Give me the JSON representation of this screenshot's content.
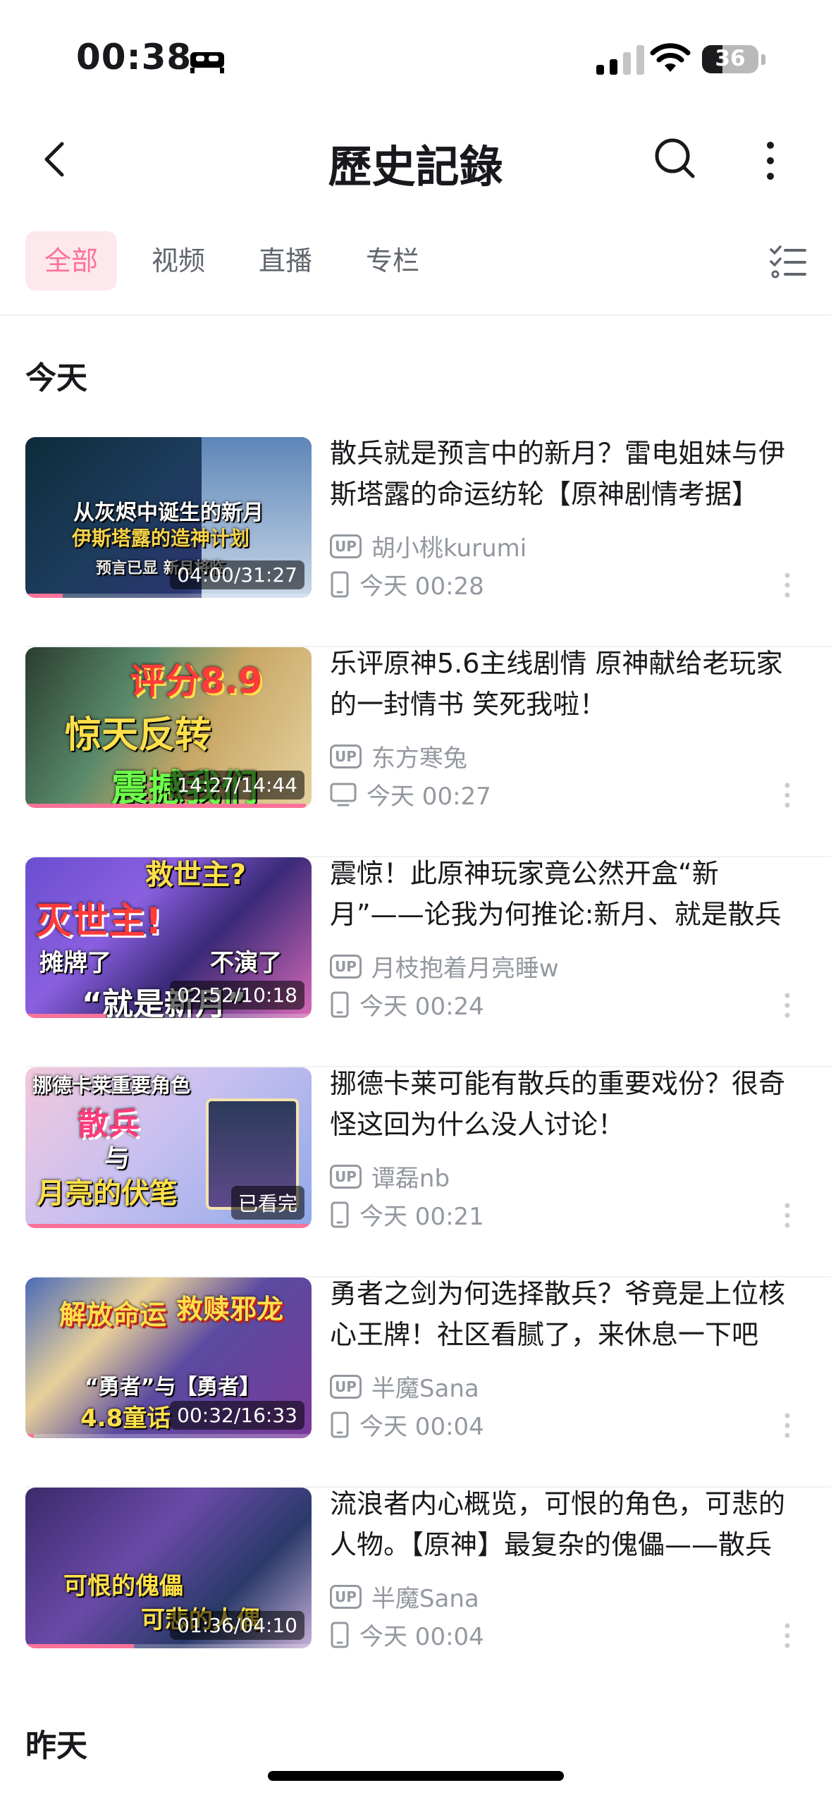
{
  "status_bar": {
    "time": "00:38",
    "battery": "36",
    "battery_level": 0.36
  },
  "header": {
    "title": "歷史記錄"
  },
  "tabs": [
    {
      "label": "全部",
      "active": true
    },
    {
      "label": "视频",
      "active": false
    },
    {
      "label": "直播",
      "active": false
    },
    {
      "label": "专栏",
      "active": false
    }
  ],
  "sections": {
    "today": "今天",
    "yesterday": "昨天"
  },
  "up_badge": "UP",
  "items": [
    {
      "title": "散兵就是预言中的新月？雷电姐妹与伊斯塔露的命运纺轮【原神剧情考据】",
      "author": "胡小桃kurumi",
      "time": "今天 00:28",
      "device": "phone",
      "overlay": "04:00/31:27",
      "progress": 0.13,
      "thumb_texts": [
        "从灰烬中诞生的新月",
        "伊斯塔露的造神计划",
        "预言已显 新月将临"
      ]
    },
    {
      "title": "乐评原神5.6主线剧情 原神献给老玩家的一封情书 笑死我啦！",
      "author": "东方寒兔",
      "time": "今天 00:27",
      "device": "tv",
      "overlay": "14:27/14:44",
      "progress": 0.98,
      "thumb_texts": [
        "评分8.9",
        "惊天反转",
        "震撼我们"
      ]
    },
    {
      "title": "震惊！此原神玩家竟公然开盒“新月”——论我为何推论:新月、就是散兵",
      "author": "月枝抱着月亮睡w",
      "time": "今天 00:24",
      "device": "phone",
      "overlay": "02:52/10:18",
      "progress": 0.28,
      "thumb_texts": [
        "救世主?",
        "灭世主!",
        "摊牌了",
        "不演了",
        "“就是新月”"
      ]
    },
    {
      "title": "挪德卡莱可能有散兵的重要戏份？很奇怪这回为什么没人讨论！",
      "author": "谭磊nb",
      "time": "今天 00:21",
      "device": "phone",
      "overlay": "已看完",
      "progress": 1.0,
      "thumb_texts": [
        "挪德卡莱重要角色",
        "散兵",
        "与",
        "月亮的伏笔"
      ]
    },
    {
      "title": "勇者之剑为何选择散兵？爷竟是上位核心王牌！社区看腻了，来休息一下吧",
      "author": "半魔Sana",
      "time": "今天 00:04",
      "device": "phone",
      "overlay": "00:32/16:33",
      "progress": 0.03,
      "thumb_texts": [
        "解放命运",
        "救赎邪龙",
        "“勇者”与【勇者】",
        "4.8童话"
      ]
    },
    {
      "title": "流浪者内心概览，可恨的角色，可悲的人物。【原神】最复杂的傀儡——散兵",
      "author": "半魔Sana",
      "time": "今天 00:04",
      "device": "phone",
      "overlay": "01:36/04:10",
      "progress": 0.38,
      "thumb_texts": [
        "可恨的傀儡",
        "可悲的人偶"
      ]
    }
  ],
  "colors": {
    "accent": "#fb7299",
    "text": "#18191c",
    "secondary": "#9499a0"
  }
}
